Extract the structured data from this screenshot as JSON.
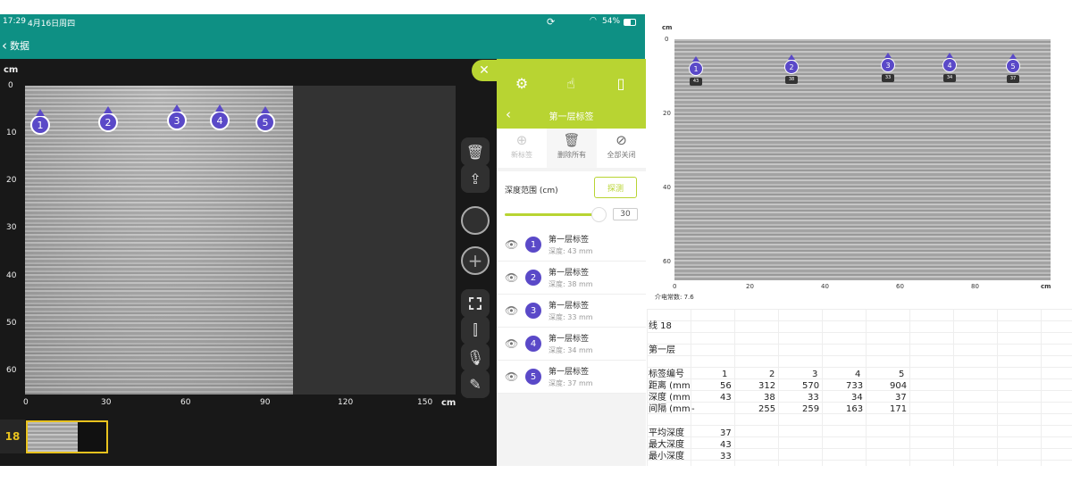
{
  "status": {
    "time": "17:29",
    "date": "4月16日周四",
    "battery": "54%"
  },
  "nav": {
    "back_label": "数据"
  },
  "viewer": {
    "y_unit": "cm",
    "x_unit": "cm",
    "y_ticks": [
      "0",
      "10",
      "20",
      "30",
      "40",
      "50",
      "60"
    ],
    "x_ticks": [
      "0",
      "30",
      "60",
      "90",
      "120",
      "150"
    ],
    "markers": [
      "1",
      "2",
      "3",
      "4",
      "5"
    ],
    "thumb_label": "18"
  },
  "panel": {
    "title": "第一层标签",
    "actions": {
      "new": "新标签",
      "delete_all": "删除所有",
      "hide_all": "全部关闭"
    },
    "depth_range_label": "深度范围 (cm)",
    "detect_button": "探测",
    "slider_value": "30",
    "items": [
      {
        "num": "1",
        "name": "第一层标签",
        "depth": "深度: 43 mm"
      },
      {
        "num": "2",
        "name": "第一层标签",
        "depth": "深度: 38 mm"
      },
      {
        "num": "3",
        "name": "第一层标签",
        "depth": "深度: 33 mm"
      },
      {
        "num": "4",
        "name": "第一层标签",
        "depth": "深度: 34 mm"
      },
      {
        "num": "5",
        "name": "第一层标签",
        "depth": "深度: 37 mm"
      }
    ]
  },
  "doc": {
    "y_unit": "cm",
    "x_unit": "cm",
    "y_ticks": [
      "0",
      "20",
      "40",
      "60"
    ],
    "x_ticks": [
      "0",
      "20",
      "40",
      "60",
      "80"
    ],
    "markers": [
      "1",
      "2",
      "3",
      "4",
      "5"
    ],
    "marker_depths": [
      "43",
      "38",
      "33",
      "34",
      "37"
    ],
    "dielectric": "介电常数: 7.6",
    "table": {
      "line": "线 18",
      "layer": "第一层",
      "rows": [
        {
          "label": "标签编号",
          "vals": [
            "1",
            "2",
            "3",
            "4",
            "5"
          ]
        },
        {
          "label": "距离 (mm",
          "vals": [
            "56",
            "312",
            "570",
            "733",
            "904"
          ]
        },
        {
          "label": "深度 (mm",
          "vals": [
            "43",
            "38",
            "33",
            "34",
            "37"
          ]
        },
        {
          "label": "间隔 (mm",
          "vals": [
            "-",
            "255",
            "259",
            "163",
            "171"
          ]
        }
      ],
      "stats": [
        {
          "label": "平均深度",
          "val": "37"
        },
        {
          "label": "最大深度",
          "val": "43"
        },
        {
          "label": "最小深度",
          "val": "33"
        }
      ]
    }
  }
}
